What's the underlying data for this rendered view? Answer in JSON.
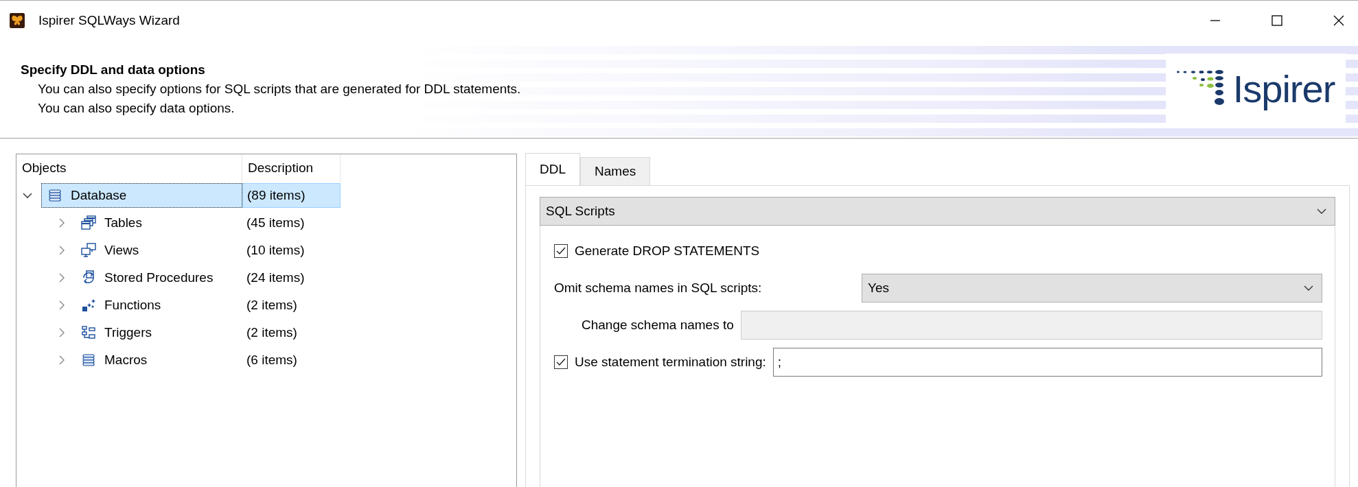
{
  "window": {
    "title": "Ispirer SQLWays Wizard"
  },
  "header": {
    "title": "Specify DDL and data options",
    "lines": [
      "You can also specify options for SQL scripts that are generated for DDL statements.",
      "You can also specify data options."
    ]
  },
  "logo": {
    "text": "Ispirer"
  },
  "tree": {
    "columns": [
      "Objects",
      "Description"
    ],
    "items": [
      {
        "label": "Database",
        "description": "(89 items)",
        "kind": "database",
        "selected": true,
        "expanded": true,
        "children": [
          {
            "label": "Tables",
            "description": "(45 items)",
            "kind": "tables",
            "selected": false,
            "expanded": false
          },
          {
            "label": "Views",
            "description": "(10 items)",
            "kind": "views",
            "selected": false,
            "expanded": false
          },
          {
            "label": "Stored Procedures",
            "description": "(24 items)",
            "kind": "procedures",
            "selected": false,
            "expanded": false
          },
          {
            "label": "Functions",
            "description": "(2 items)",
            "kind": "functions",
            "selected": false,
            "expanded": false
          },
          {
            "label": "Triggers",
            "description": "(2 items)",
            "kind": "triggers",
            "selected": false,
            "expanded": false
          },
          {
            "label": "Macros",
            "description": "(6 items)",
            "kind": "database",
            "selected": false,
            "expanded": false
          }
        ]
      }
    ]
  },
  "tabs": [
    {
      "label": "DDL",
      "selected": true
    },
    {
      "label": "Names",
      "selected": false
    }
  ],
  "section": {
    "value": "SQL Scripts"
  },
  "options": [
    {
      "kind": "checkbox",
      "label": "Generate DROP STATEMENTS",
      "checked": true
    },
    {
      "kind": "select",
      "label": "Omit schema names in SQL scripts:",
      "value": "Yes"
    },
    {
      "kind": "text",
      "label": "Change schema names to",
      "disabled": true
    },
    {
      "kind": "checkbox-text",
      "label": "Use statement termination string:",
      "checked": true,
      "value": ";"
    }
  ]
}
